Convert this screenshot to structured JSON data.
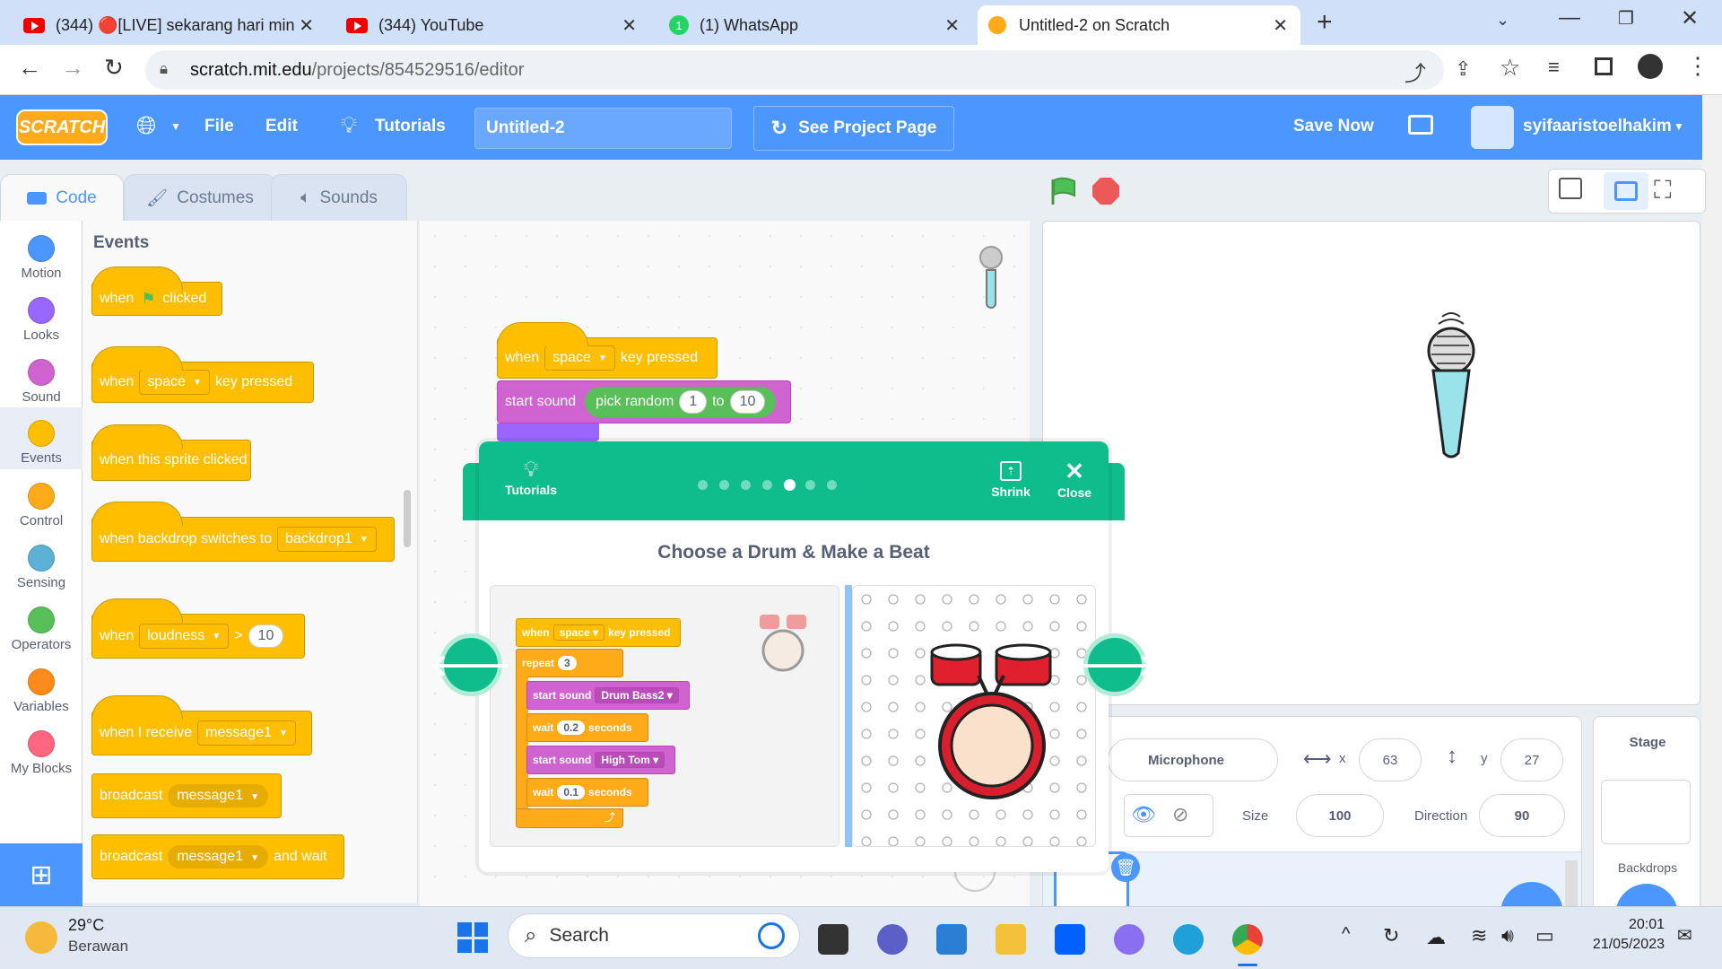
{
  "browser": {
    "tabs": [
      {
        "title": "(344) 🔴[LIVE] sekarang hari min",
        "icon": "youtube-icon"
      },
      {
        "title": "(344) YouTube",
        "icon": "youtube-icon"
      },
      {
        "title": "(1) WhatsApp",
        "icon": "whatsapp-icon"
      },
      {
        "title": "Untitled-2 on Scratch",
        "icon": "scratch-icon"
      }
    ],
    "url_host": "scratch.mit.edu",
    "url_path": "/projects/854529516/editor"
  },
  "scratch": {
    "logo": "SCRATCH",
    "menu": {
      "file": "File",
      "edit": "Edit",
      "tutorials": "Tutorials",
      "see_project": "See Project Page",
      "save_now": "Save Now",
      "username": "syifaaristoelhakim"
    },
    "project_title": "Untitled-2",
    "editor_tabs": {
      "code": "Code",
      "costumes": "Costumes",
      "sounds": "Sounds"
    },
    "categories": [
      {
        "label": "Motion",
        "color": "#4c97ff"
      },
      {
        "label": "Looks",
        "color": "#9966ff"
      },
      {
        "label": "Sound",
        "color": "#cf63cf"
      },
      {
        "label": "Events",
        "color": "#ffbf00"
      },
      {
        "label": "Control",
        "color": "#ffab19"
      },
      {
        "label": "Sensing",
        "color": "#5cb1d6"
      },
      {
        "label": "Operators",
        "color": "#59c059"
      },
      {
        "label": "Variables",
        "color": "#ff8c1a"
      },
      {
        "label": "My Blocks",
        "color": "#ff6680"
      }
    ],
    "palette": {
      "heading": "Events",
      "when": "when",
      "clicked": "clicked",
      "key_pressed": "key pressed",
      "space": "space",
      "sprite_clicked": "when this sprite clicked",
      "backdrop_switches": "when backdrop switches to",
      "backdrop1": "backdrop1",
      "loudness": "loudness",
      "gt": ">",
      "ten": "10",
      "receive": "when I receive",
      "message1": "message1",
      "broadcast": "broadcast",
      "and_wait": "and wait"
    },
    "script": {
      "when": "when",
      "space": "space",
      "key_pressed": "key pressed",
      "start_sound": "start sound",
      "pick_random": "pick random",
      "from": "1",
      "to_label": "to",
      "to": "10"
    },
    "tutorial": {
      "label": "Tutorials",
      "shrink": "Shrink",
      "close": "Close",
      "title": "Choose a Drum & Make a Beat",
      "steps": 7,
      "current_step": 5,
      "blocks": {
        "when": "when",
        "space": "space",
        "key_pressed": "key pressed",
        "repeat": "repeat",
        "repeat_n": "3",
        "start_sound": "start sound",
        "sound1": "Drum Bass2",
        "sound2": "High Tom",
        "wait": "wait",
        "wait1": "0.2",
        "wait2": "0.1",
        "seconds": "seconds"
      }
    },
    "sprite": {
      "name": "Microphone",
      "x_label": "x",
      "x": "63",
      "y_label": "y",
      "y": "27",
      "size_label": "Size",
      "size": "100",
      "direction_label": "Direction",
      "direction": "90"
    },
    "stage_panel": {
      "title": "Stage",
      "backdrops": "Backdrops"
    }
  },
  "taskbar": {
    "weather_temp": "29°C",
    "weather_desc": "Berawan",
    "search": "Search",
    "time": "20:01",
    "date": "21/05/2023"
  }
}
